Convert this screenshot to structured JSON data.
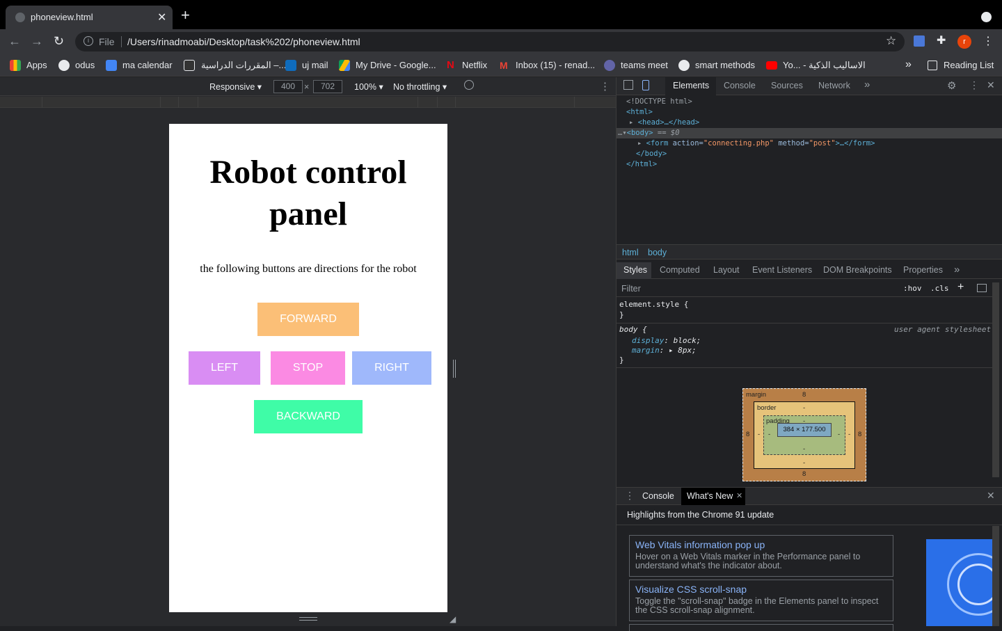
{
  "browser": {
    "tab_title": "phoneview.html",
    "tab_close": "✕",
    "new_tab": "+",
    "omnibox_scheme": "File",
    "omnibox_url": "/Users/rinadmoabi/Desktop/task%202/phoneview.html",
    "profile_initial": "r"
  },
  "bookmarks": [
    {
      "label": "Apps",
      "icon": "apps-grid-icon"
    },
    {
      "label": "odus",
      "icon": "globe-icon"
    },
    {
      "label": "ma calendar",
      "icon": "calendar-icon"
    },
    {
      "label": "المقررات الدراسية –...",
      "icon": "blackboard-icon"
    },
    {
      "label": "uj mail",
      "icon": "outlook-icon"
    },
    {
      "label": "My Drive - Google...",
      "icon": "drive-icon"
    },
    {
      "label": "Netflix",
      "icon": "netflix-icon"
    },
    {
      "label": "Inbox (15) - renad...",
      "icon": "gmail-icon"
    },
    {
      "label": "teams meet",
      "icon": "teams-icon"
    },
    {
      "label": "smart methods",
      "icon": "globe-icon"
    },
    {
      "label": "Yo... - الاساليب الذكية",
      "icon": "youtube-icon"
    }
  ],
  "bookmarks_overflow": "»",
  "reading_list": "Reading List",
  "device_toolbar": {
    "mode": "Responsive ▾",
    "width": "400",
    "times": "×",
    "height": "702",
    "zoom": "100% ▾",
    "throttling": "No throttling ▾"
  },
  "page": {
    "heading": "Robot control panel",
    "description": "the following buttons are directions for the robot",
    "buttons": {
      "forward": "FORWARD",
      "left": "LEFT",
      "stop": "STOP",
      "right": "RIGHT",
      "backward": "BACKWARD"
    },
    "colors": {
      "forward": "#fbbf77",
      "left": "#d98df3",
      "stop": "#fb8ae3",
      "right": "#9fb8fb",
      "backward": "#3ffca7"
    }
  },
  "devtools": {
    "tabs": [
      "Elements",
      "Console",
      "Sources",
      "Network"
    ],
    "tabs_overflow": "»",
    "dom": {
      "line1": "<!DOCTYPE html>",
      "html_open": "<html>",
      "head": "<head>…</head>",
      "body_open": "<body>",
      "body_suffix": " == $0",
      "form_tag": "<form ",
      "form_action_attr": "action=",
      "form_action_val": "\"connecting.php\"",
      "form_method_attr": " method=",
      "form_method_val": "\"post\"",
      "form_close": ">…</form>",
      "body_close": "</body>",
      "html_close": "</html>"
    },
    "breadcrumbs": [
      "html",
      "body"
    ],
    "subtabs": [
      "Styles",
      "Computed",
      "Layout",
      "Event Listeners",
      "DOM Breakpoints",
      "Properties"
    ],
    "subtabs_overflow": "»",
    "filter_placeholder": "Filter",
    "hov": ":hov",
    "cls": ".cls",
    "plus": "+",
    "element_style_open": "element.style {",
    "brace_close": "}",
    "body_selector": "body {",
    "ua_label": "user agent stylesheet",
    "prop_display_name": "display",
    "prop_display_value": ": block;",
    "prop_margin_name": "margin",
    "prop_margin_value": ": ▸ 8px;",
    "box_model": {
      "margin_label": "margin",
      "border_label": "border",
      "padding_label": "padding",
      "margin_top": "8",
      "margin_bottom": "8",
      "margin_left": "8",
      "margin_right": "8",
      "dash": "-",
      "content": "384 × 177.500"
    },
    "drawer_tabs": [
      "Console",
      "What's New"
    ],
    "drawer_close": "✕",
    "whats_new_heading": "Highlights from the Chrome 91 update",
    "cards": [
      {
        "title": "Web Vitals information pop up",
        "desc": "Hover on a Web Vitals marker in the Performance panel to understand what's the indicator about."
      },
      {
        "title": "Visualize CSS scroll-snap",
        "desc": "Toggle the \"scroll-snap\" badge in the Elements panel to inspect the CSS scroll-snap alignment."
      }
    ]
  }
}
